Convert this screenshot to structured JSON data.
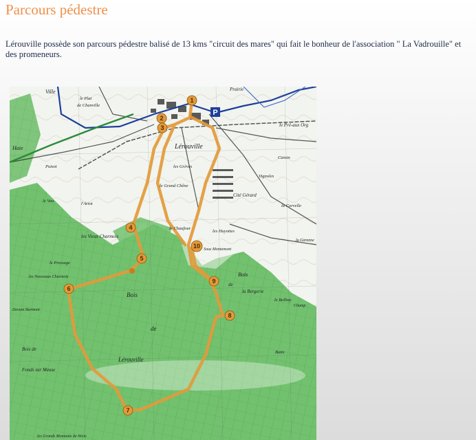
{
  "page": {
    "title": "Parcours pédestre",
    "intro": "Lérouville possède son parcours pédestre balisé de 13 kms \"circuit des mares\" qui fait le bonheur de l'association \" La Vadrouille\" et des promeneurs."
  },
  "map": {
    "route_color": "#e39a3a",
    "forest_color": "#6dbf6a",
    "parking_label": "P",
    "waypoints": [
      "1",
      "2",
      "3",
      "4",
      "5",
      "6",
      "7",
      "8",
      "9",
      "10"
    ],
    "labels": {
      "ville": "Ville",
      "le_plat": "le Plat",
      "de_chanville": "de Chanville",
      "prairie": "Prairie",
      "le_pre_aux_org": "le Pré-aux Org",
      "lerouville_town": "Lérouville",
      "les_greves": "les Grèves",
      "le_grand_chene": "le Grand Chêne",
      "cite_gerard": "Cité Gérard",
      "vignoles": "Vignoles",
      "la_corvelle": "la Corvelle",
      "le_chaufour": "le Chaufour",
      "les_huyottes": "les Huyottes",
      "sous_montemont": "Sous Montemont",
      "les_vieux_charmois": "les Vieux Charmois",
      "le_pressage": "le Pressage",
      "les_nouveaux_charmois": "les Nouveaux Charmois",
      "bois": "Bois",
      "de": "de",
      "bois_lerouville": "Lérouville",
      "bois_right": "Bois",
      "de_right": "de",
      "la_bergerie": "la Bergerie",
      "le_bolhay": "le Bolhay",
      "champ": "Champ",
      "devant_barmont": "Devant Barmont",
      "bois_de_fonds": "Bois de",
      "fonds_sur_meuse": "Fonds sur Meuse",
      "les_grands_montants": "les Grands Montants de Nivie",
      "la_haie": "Haie",
      "l_aviot": "l'Aviot",
      "le_vau": "le Vau",
      "puisot": "Puisot",
      "cussin": "Cussin",
      "la_garenne": "la Garenne",
      "butte": "Butte"
    }
  }
}
